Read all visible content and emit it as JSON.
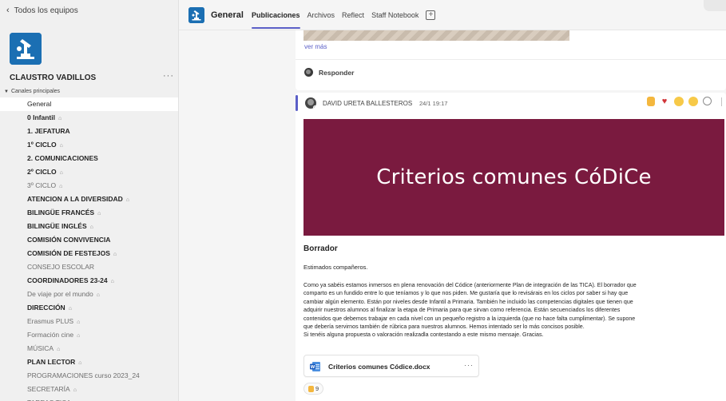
{
  "team_pane": {
    "back_label": "Todos los equipos",
    "team_name": "CLAUSTRO VADILLOS",
    "more": "···",
    "section_label": "Canales principales",
    "channels": [
      {
        "label": "General",
        "style": "active",
        "locked": false
      },
      {
        "label": "0 Infantil",
        "style": "bold",
        "locked": true
      },
      {
        "label": "1. JEFATURA",
        "style": "bold",
        "locked": false
      },
      {
        "label": "1º CICLO",
        "style": "bold",
        "locked": true
      },
      {
        "label": "2. COMUNICACIONES",
        "style": "bold",
        "locked": false
      },
      {
        "label": "2º CICLO",
        "style": "bold",
        "locked": true
      },
      {
        "label": "3º CICLO",
        "style": "dim",
        "locked": true
      },
      {
        "label": "ATENCION A LA DIVERSIDAD",
        "style": "bold",
        "locked": true
      },
      {
        "label": "BILINGÜE FRANCÉS",
        "style": "bold",
        "locked": true
      },
      {
        "label": "BILINGÜE INGLÉS",
        "style": "bold",
        "locked": true
      },
      {
        "label": "COMISIÓN CONVIVENCIA",
        "style": "bold",
        "locked": false
      },
      {
        "label": "COMISIÓN DE FESTEJOS",
        "style": "bold",
        "locked": true
      },
      {
        "label": "CONSEJO ESCOLAR",
        "style": "dim",
        "locked": false
      },
      {
        "label": "COORDINADORES 23-24",
        "style": "bold",
        "locked": true
      },
      {
        "label": "De viaje por el mundo",
        "style": "dim",
        "locked": true
      },
      {
        "label": "DIRECCIÓN",
        "style": "bold",
        "locked": true
      },
      {
        "label": "Erasmus PLUS",
        "style": "dim",
        "locked": true
      },
      {
        "label": "Formación cine",
        "style": "dim",
        "locked": true
      },
      {
        "label": "MÚSICA",
        "style": "dim",
        "locked": true
      },
      {
        "label": "PLAN LECTOR",
        "style": "bold",
        "locked": true
      },
      {
        "label": "PROGRAMACIONES curso 2023_24",
        "style": "dim",
        "locked": false
      },
      {
        "label": "SECRETARÍA",
        "style": "dim",
        "locked": true
      },
      {
        "label": "TAREAS TICA",
        "style": "dim",
        "locked": false
      }
    ]
  },
  "header": {
    "channel_title": "General",
    "tabs": [
      {
        "label": "Publicaciones",
        "active": true
      },
      {
        "label": "Archivos",
        "active": false
      },
      {
        "label": "Reflect",
        "active": false
      },
      {
        "label": "Staff Notebook",
        "active": false
      }
    ],
    "add_tab": "+"
  },
  "feed": {
    "previous_post": {
      "see_more": "ver más",
      "reply_label": "Responder"
    },
    "post": {
      "author": "DAVID URETA BALLESTEROS",
      "timestamp": "24/1 19:17",
      "banner_text": "Criterios comunes CóDiCe",
      "subject": "Borrador",
      "greeting": "Estimados compañeros.",
      "body_lines": [
        "Como ya sabéis estamos inmersos en plena renovación del Códice (anteriormente Plan de integración de las TICA). El borrador que",
        "comparto es un fundido entre lo que teníamos y lo que nos piden. Me gustaría que lo revisárais en los ciclos por saber si hay que",
        "cambiar algún elemento. Están por niveles desde Infantil a Primaria. También he incluido las competencias digitales que tienen que",
        "adquirir nuestros alumnos al finalizar la etapa de Primaria para que sirvan como referencia. Están secuenciados los diferentes",
        "contenidos que debemos trabajar en cada nivel con un pequeño registro a la izquierda (que no hace falta cumplimentar). Se supone",
        "que debería servirnos también de rúbrica para nuestros alumnos. Hemos intentado ser lo más concisos posible.",
        "Si tenéis alguna propuesta o valoración realizadla contestando a este mismo mensaje. Gracias."
      ],
      "attachment": {
        "name": "Criterios comunes Códice.docx",
        "more": "···"
      },
      "reaction_count": "9"
    }
  },
  "colors": {
    "accent": "#5b5fc7",
    "banner": "#7a1a3f",
    "team_logo": "#1b6fb3"
  }
}
